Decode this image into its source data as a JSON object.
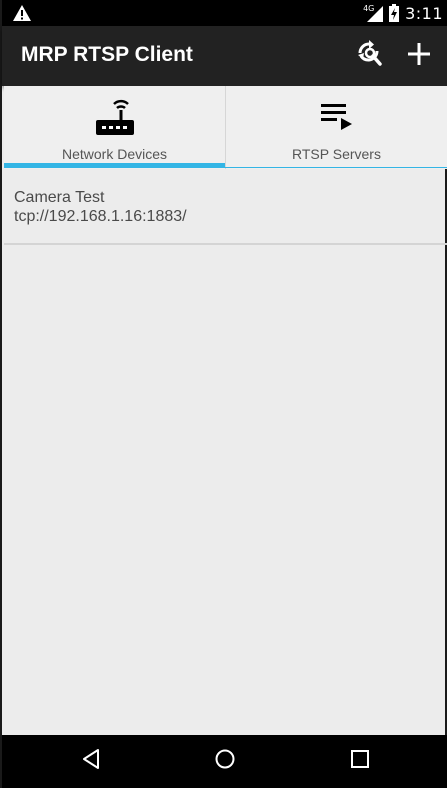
{
  "status_bar": {
    "network_label": "4G",
    "time": "3:11",
    "warning_icon": "warning-icon",
    "battery_icon": "battery-charging-icon"
  },
  "app_bar": {
    "title": "MRP RTSP Client",
    "actions": [
      {
        "icon": "refresh-search-icon"
      },
      {
        "icon": "add-icon"
      }
    ]
  },
  "tabs": [
    {
      "label": "Network Devices",
      "icon": "router-icon",
      "selected": true
    },
    {
      "label": "RTSP Servers",
      "icon": "playlist-play-icon",
      "selected": false
    }
  ],
  "devices": [
    {
      "name": "Camera Test",
      "address": "tcp://192.168.1.16:1883/"
    }
  ],
  "nav_bar": {
    "back_icon": "back-icon",
    "home_icon": "home-icon",
    "recents_icon": "recents-icon"
  },
  "colors": {
    "accent": "#33b5e5",
    "app_bar": "#222222",
    "background": "#ececec"
  }
}
